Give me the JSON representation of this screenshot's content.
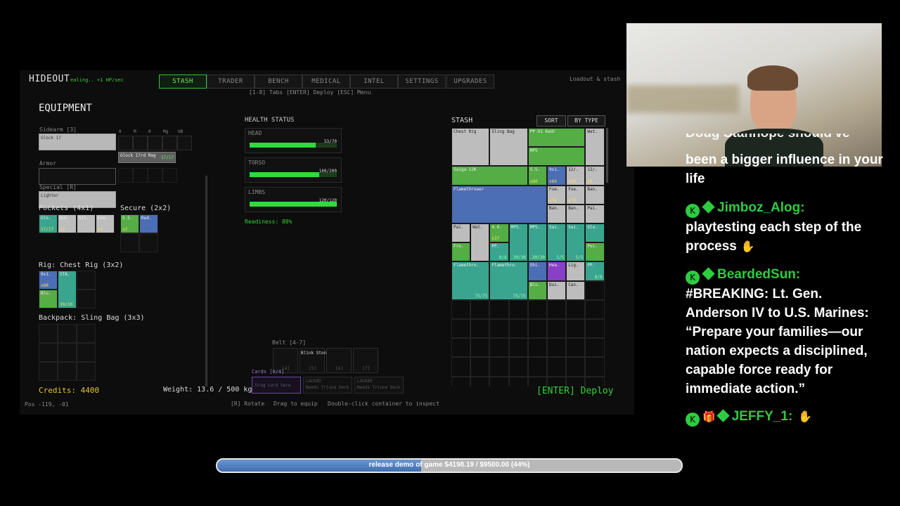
{
  "game": {
    "title": "HIDEOUT",
    "healing": "ealing.. +1 HP/sec",
    "tabs": [
      "STASH",
      "TRADER",
      "BENCH",
      "MEDICAL",
      "INTEL",
      "SETTINGS",
      "UPGRADES"
    ],
    "active_tab": "STASH",
    "tabs_hint": "[1-8] Tabs  [ENTER] Deploy  [ESC] Menu",
    "right_label": "Loadout & stash",
    "equipment_title": "EQUIPMENT",
    "sidearm_label": "Sidearm [3]",
    "sidearm_item": "Glock 17",
    "ammo_labels": [
      "0",
      "M",
      "0",
      "Mg",
      "UB"
    ],
    "mag_item": "Glock 17rd Mag",
    "mag_count": "17/17",
    "armor_label": "Armor",
    "special_label": "Special [R]",
    "special_item": "Lighter",
    "pockets_label": "Pockets (4x1)",
    "pockets": [
      {
        "name": "Glo.",
        "sub": "17/17",
        "color": "#39a58f"
      },
      {
        "name": "Dui.",
        "sub": "x3",
        "color": "#bdbdbd"
      },
      {
        "name": "Sil.",
        "sub": "",
        "color": "#bdbdbd"
      },
      {
        "name": "Ene.",
        "sub": "x4",
        "color": "#bdbdbd"
      }
    ],
    "secure_label": "Secure (2x2)",
    "secure": [
      {
        "name": "5.5.",
        "sub": "x2",
        "color": "#54ad45"
      },
      {
        "name": "Red.",
        "sub": "",
        "color": "#4b6eb5"
      }
    ],
    "rig_label": "Rig: Chest Rig (3x2)",
    "rig_items": [
      {
        "name": "9x1.",
        "sub": "x60"
      },
      {
        "name": "STA.",
        "sub": "30/30"
      },
      {
        "name": "Blu.",
        "sub": ""
      }
    ],
    "backpack_label": "Backpack: Sling Bag (3x3)",
    "credits": "Credits: 4400",
    "pos": "Pos -119, -01",
    "health_title": "HEALTH STATUS",
    "health": [
      {
        "part": "HEAD",
        "value": "53/70",
        "pct": 0.76
      },
      {
        "part": "TORSO",
        "value": "160/200",
        "pct": 0.8
      },
      {
        "part": "LIMBS",
        "value": "120/120",
        "pct": 1.0
      }
    ],
    "readiness": "Readiness: 88%",
    "belt_label": "Belt [4-7]",
    "belt_item": "Blink Stone",
    "belt_keys": [
      "[4]",
      "[5]",
      "[6]",
      "[7]"
    ],
    "cards_label": "Cards [0/4]",
    "cards_drag": "Drag card here",
    "locked": [
      "LOCKED",
      "LOCKED"
    ],
    "locked_sub": [
      "Needs Triune Deck",
      "Needs Triune Deck"
    ],
    "weight": "Weight: 13.6 / 500 kg",
    "hint_rotate": "[R] Rotate",
    "hint_drag": "Drag to equip",
    "hint_dbl": "Double-click container to inspect",
    "deploy": "[ENTER] Deploy",
    "stash_title": "STASH",
    "sort_btn": "SORT",
    "bytype_btn": "BY TYPE",
    "stash_items": [
      {
        "name": "Chest Rig",
        "q": "",
        "d": "",
        "c": "i-gray"
      },
      {
        "name": "Sling Bag",
        "q": "",
        "d": "",
        "c": "i-gray"
      },
      {
        "name": "PP-91 Kedr",
        "q": "",
        "d": "",
        "c": "i-green"
      },
      {
        "name": "Wat.",
        "q": "",
        "d": "",
        "c": "i-gray"
      },
      {
        "name": "MP5",
        "q": "",
        "d": "",
        "c": "i-green"
      },
      {
        "name": "Saiga-12K",
        "q": "",
        "d": "",
        "c": "i-green"
      },
      {
        "name": "5.5.",
        "q": "x60",
        "d": "",
        "c": "i-green"
      },
      {
        "name": "9x1.",
        "q": "x60",
        "d": "",
        "c": "i-blue"
      },
      {
        "name": "12/.",
        "q": "x20",
        "d": "",
        "c": "i-gray"
      },
      {
        "name": "12/.",
        "q": "x8",
        "d": "",
        "c": "i-gray"
      },
      {
        "name": "Flamethrower",
        "q": "",
        "d": "",
        "c": "i-blue"
      },
      {
        "name": "Fue.",
        "q": "x75",
        "d": "",
        "c": "i-gray"
      },
      {
        "name": "Fue.",
        "q": "x75",
        "d": "",
        "c": "i-gray"
      },
      {
        "name": "Ban.",
        "q": "",
        "d": "",
        "c": "i-gray"
      },
      {
        "name": "Ban.",
        "q": "",
        "d": "",
        "c": "i-gray"
      },
      {
        "name": "Ban.",
        "q": "",
        "d": "",
        "c": "i-gray"
      },
      {
        "name": "Pai.",
        "q": "",
        "d": "",
        "c": "i-gray"
      },
      {
        "name": "Pai.",
        "q": "",
        "d": "",
        "c": "i-gray"
      },
      {
        "name": "Wat.",
        "q": "",
        "d": "",
        "c": "i-gray"
      },
      {
        "name": "4.6.",
        "q": "x37",
        "d": "",
        "c": "i-green"
      },
      {
        "name": "MP5.",
        "q": "",
        "d": "30/30",
        "c": "i-teal"
      },
      {
        "name": "MP5.",
        "q": "",
        "d": "30/30",
        "c": "i-teal"
      },
      {
        "name": "Sai.",
        "q": "",
        "d": "5/5",
        "c": "i-teal"
      },
      {
        "name": "Sai.",
        "q": "",
        "d": "5/5",
        "c": "i-teal"
      },
      {
        "name": "Glo.",
        "q": "",
        "d": "",
        "c": "i-teal"
      },
      {
        "name": "Fro.",
        "q": "",
        "d": "",
        "c": "i-green"
      },
      {
        "name": "PP.",
        "q": "",
        "d": "8/8",
        "c": "i-teal"
      },
      {
        "name": "Poi.",
        "q": "",
        "d": "",
        "c": "i-green"
      },
      {
        "name": "Flamethro.",
        "q": "",
        "d": "75/75",
        "c": "i-teal"
      },
      {
        "name": "Flamethro.",
        "q": "",
        "d": "75/75",
        "c": "i-teal"
      },
      {
        "name": "Shi.",
        "q": "",
        "d": "",
        "c": "i-blue"
      },
      {
        "name": "Hea.",
        "q": "",
        "d": "",
        "c": "i-purple"
      },
      {
        "name": "Lig.",
        "q": "",
        "d": "",
        "c": "i-gray"
      },
      {
        "name": "PP.",
        "q": "",
        "d": "8/8",
        "c": "i-teal"
      },
      {
        "name": "Blu.",
        "q": "",
        "d": "",
        "c": "i-green"
      },
      {
        "name": "Dui.",
        "q": "",
        "d": "",
        "c": "i-gray"
      },
      {
        "name": "Can.",
        "q": "",
        "d": "",
        "c": "i-gray"
      }
    ]
  },
  "chat": {
    "partial_top": "Doug Stanhope should've",
    "partial_line": "been a bigger influence in your life",
    "messages": [
      {
        "user": "Jimboz_Alog:",
        "text": "playtesting each step of the process",
        "emote": "✋",
        "gift": false
      },
      {
        "user": "BeardedSun:",
        "text": "#BREAKING: Lt. Gen. Anderson IV to U.S. Marines: “Prepare your families—our nation expects a disciplined, capable force ready for immediate action.”",
        "emote": "",
        "gift": false
      },
      {
        "user": "JEFFY_1:",
        "text": "",
        "emote": "✋",
        "gift": true
      }
    ],
    "badge_glyph": "K",
    "gift_glyph": "🎁"
  },
  "donation": {
    "label": "release demo of game $4198.19 / $9500.00 (44%)",
    "progress": 0.44
  },
  "colors": {
    "accent": "#36c23a",
    "stash_green": "#54ad45",
    "stash_blue": "#4b6eb5",
    "stash_teal": "#39a58f",
    "username": "#2ecc40",
    "deploy": "#34d137",
    "credits": "#e2c23a"
  }
}
